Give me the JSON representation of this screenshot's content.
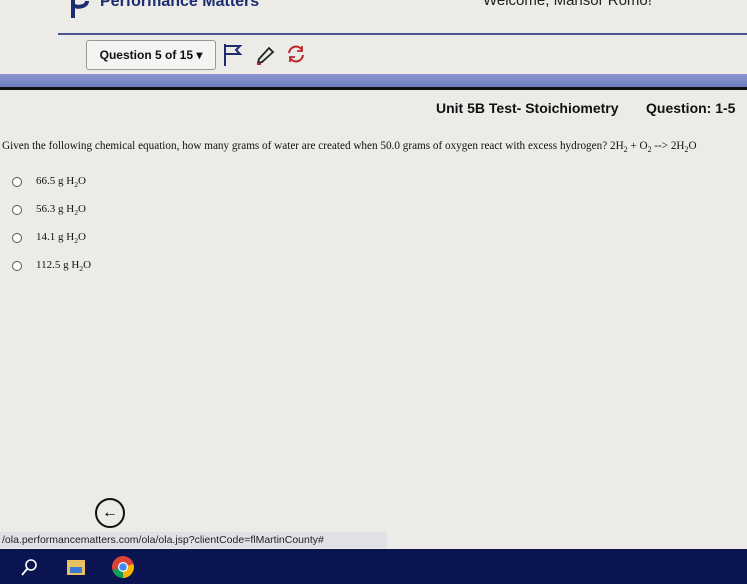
{
  "header": {
    "brand": "Performance Matters",
    "welcome": "Welcome, Mansor Romo!"
  },
  "toolbar": {
    "question_selector": "Question 5 of 15 ▾",
    "icons": [
      "flag-icon",
      "pencil-icon",
      "refresh-icon"
    ]
  },
  "test": {
    "title": "Unit 5B Test- Stoichiometry",
    "question_range": "Question: 1-5"
  },
  "question": {
    "text": "Given the following chemical equation, how many grams of water are created when 50.0 grams of oxygen react with excess hydrogen?",
    "equation": {
      "r1": "2H",
      "r1_sub": "2",
      "plus": " + O",
      "r2_sub": "2",
      "arrow": " --> 2H",
      "p_sub": "2",
      "p_end": "O"
    }
  },
  "options": [
    {
      "value": "66.5 g H",
      "sub": "2",
      "end": "O"
    },
    {
      "value": "56.3 g H",
      "sub": "2",
      "end": "O"
    },
    {
      "value": "14.1 g H",
      "sub": "2",
      "end": "O"
    },
    {
      "value": "112.5 g H",
      "sub": "2",
      "end": "O"
    }
  ],
  "footer": {
    "back_icon": "←",
    "status_url": "/ola.performancematters.com/ola/ola.jsp?clientCode=flMartinCounty#"
  },
  "taskbar": {
    "icons": [
      "search-icon",
      "file-explorer-icon",
      "chrome-icon"
    ]
  },
  "colors": {
    "brand": "#1c2c6e",
    "band": "#7b86c6",
    "taskbar": "#0a1450",
    "refresh": "#c0262c"
  }
}
